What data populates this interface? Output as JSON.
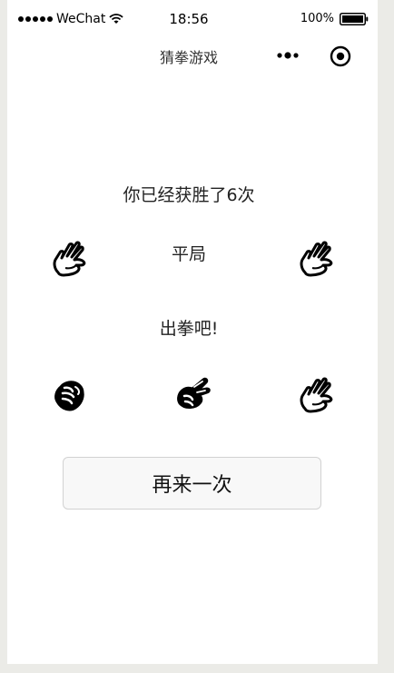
{
  "status_bar": {
    "carrier": "WeChat",
    "time": "18:56",
    "battery": "100%",
    "icons": [
      "signal-dots-icon",
      "wifi-icon",
      "battery-icon"
    ]
  },
  "nav": {
    "title": "猜拳游戏",
    "icons": [
      "more-icon",
      "target-icon"
    ]
  },
  "game": {
    "win_count_text": "你已经获胜了6次",
    "result_text": "平局",
    "prompt_text": "出拳吧!",
    "player_hand": "paper-hand-icon",
    "computer_hand": "paper-hand-icon",
    "choices": [
      "rock-hand-icon",
      "scissors-hand-icon",
      "paper-hand-icon"
    ]
  },
  "actions": {
    "retry_label": "再来一次"
  }
}
